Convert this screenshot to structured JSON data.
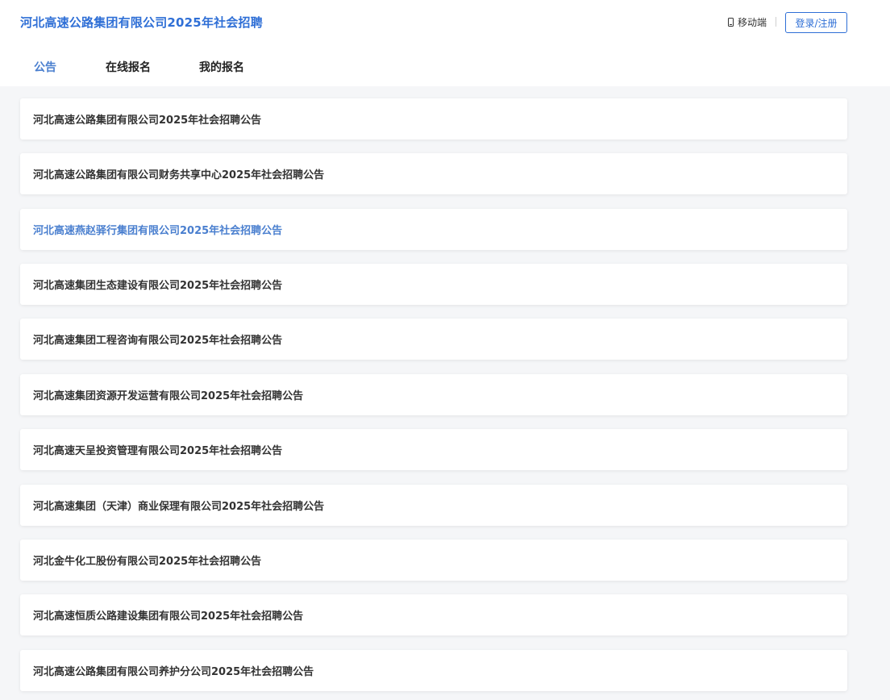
{
  "header": {
    "site_title": "河北高速公路集团有限公司2025年社会招聘",
    "mobile_label": "移动端",
    "login_label": "登录/注册"
  },
  "nav": {
    "tabs": [
      {
        "label": "公告",
        "active": true
      },
      {
        "label": "在线报名",
        "active": false
      },
      {
        "label": "我的报名",
        "active": false
      }
    ]
  },
  "announcements": [
    {
      "title": "河北高速公路集团有限公司2025年社会招聘公告"
    },
    {
      "title": "河北高速公路集团有限公司财务共享中心2025年社会招聘公告"
    },
    {
      "title": "河北高速燕赵驿行集团有限公司2025年社会招聘公告",
      "highlighted": true
    },
    {
      "title": "河北高速集团生态建设有限公司2025年社会招聘公告"
    },
    {
      "title": "河北高速集团工程咨询有限公司2025年社会招聘公告"
    },
    {
      "title": "河北高速集团资源开发运营有限公司2025年社会招聘公告"
    },
    {
      "title": "河北高速天呈投资管理有限公司2025年社会招聘公告"
    },
    {
      "title": "河北高速集团（天津）商业保理有限公司2025年社会招聘公告"
    },
    {
      "title": "河北金牛化工股份有限公司2025年社会招聘公告"
    },
    {
      "title": "河北高速恒质公路建设集团有限公司2025年社会招聘公告"
    },
    {
      "title": "河北高速公路集团有限公司养护分公司2025年社会招聘公告"
    }
  ],
  "colors": {
    "brand": "#2f6fd6",
    "active_tab": "#4a7fcf",
    "background": "#f5f6f8"
  },
  "icons": {
    "mobile": "phone-icon"
  }
}
